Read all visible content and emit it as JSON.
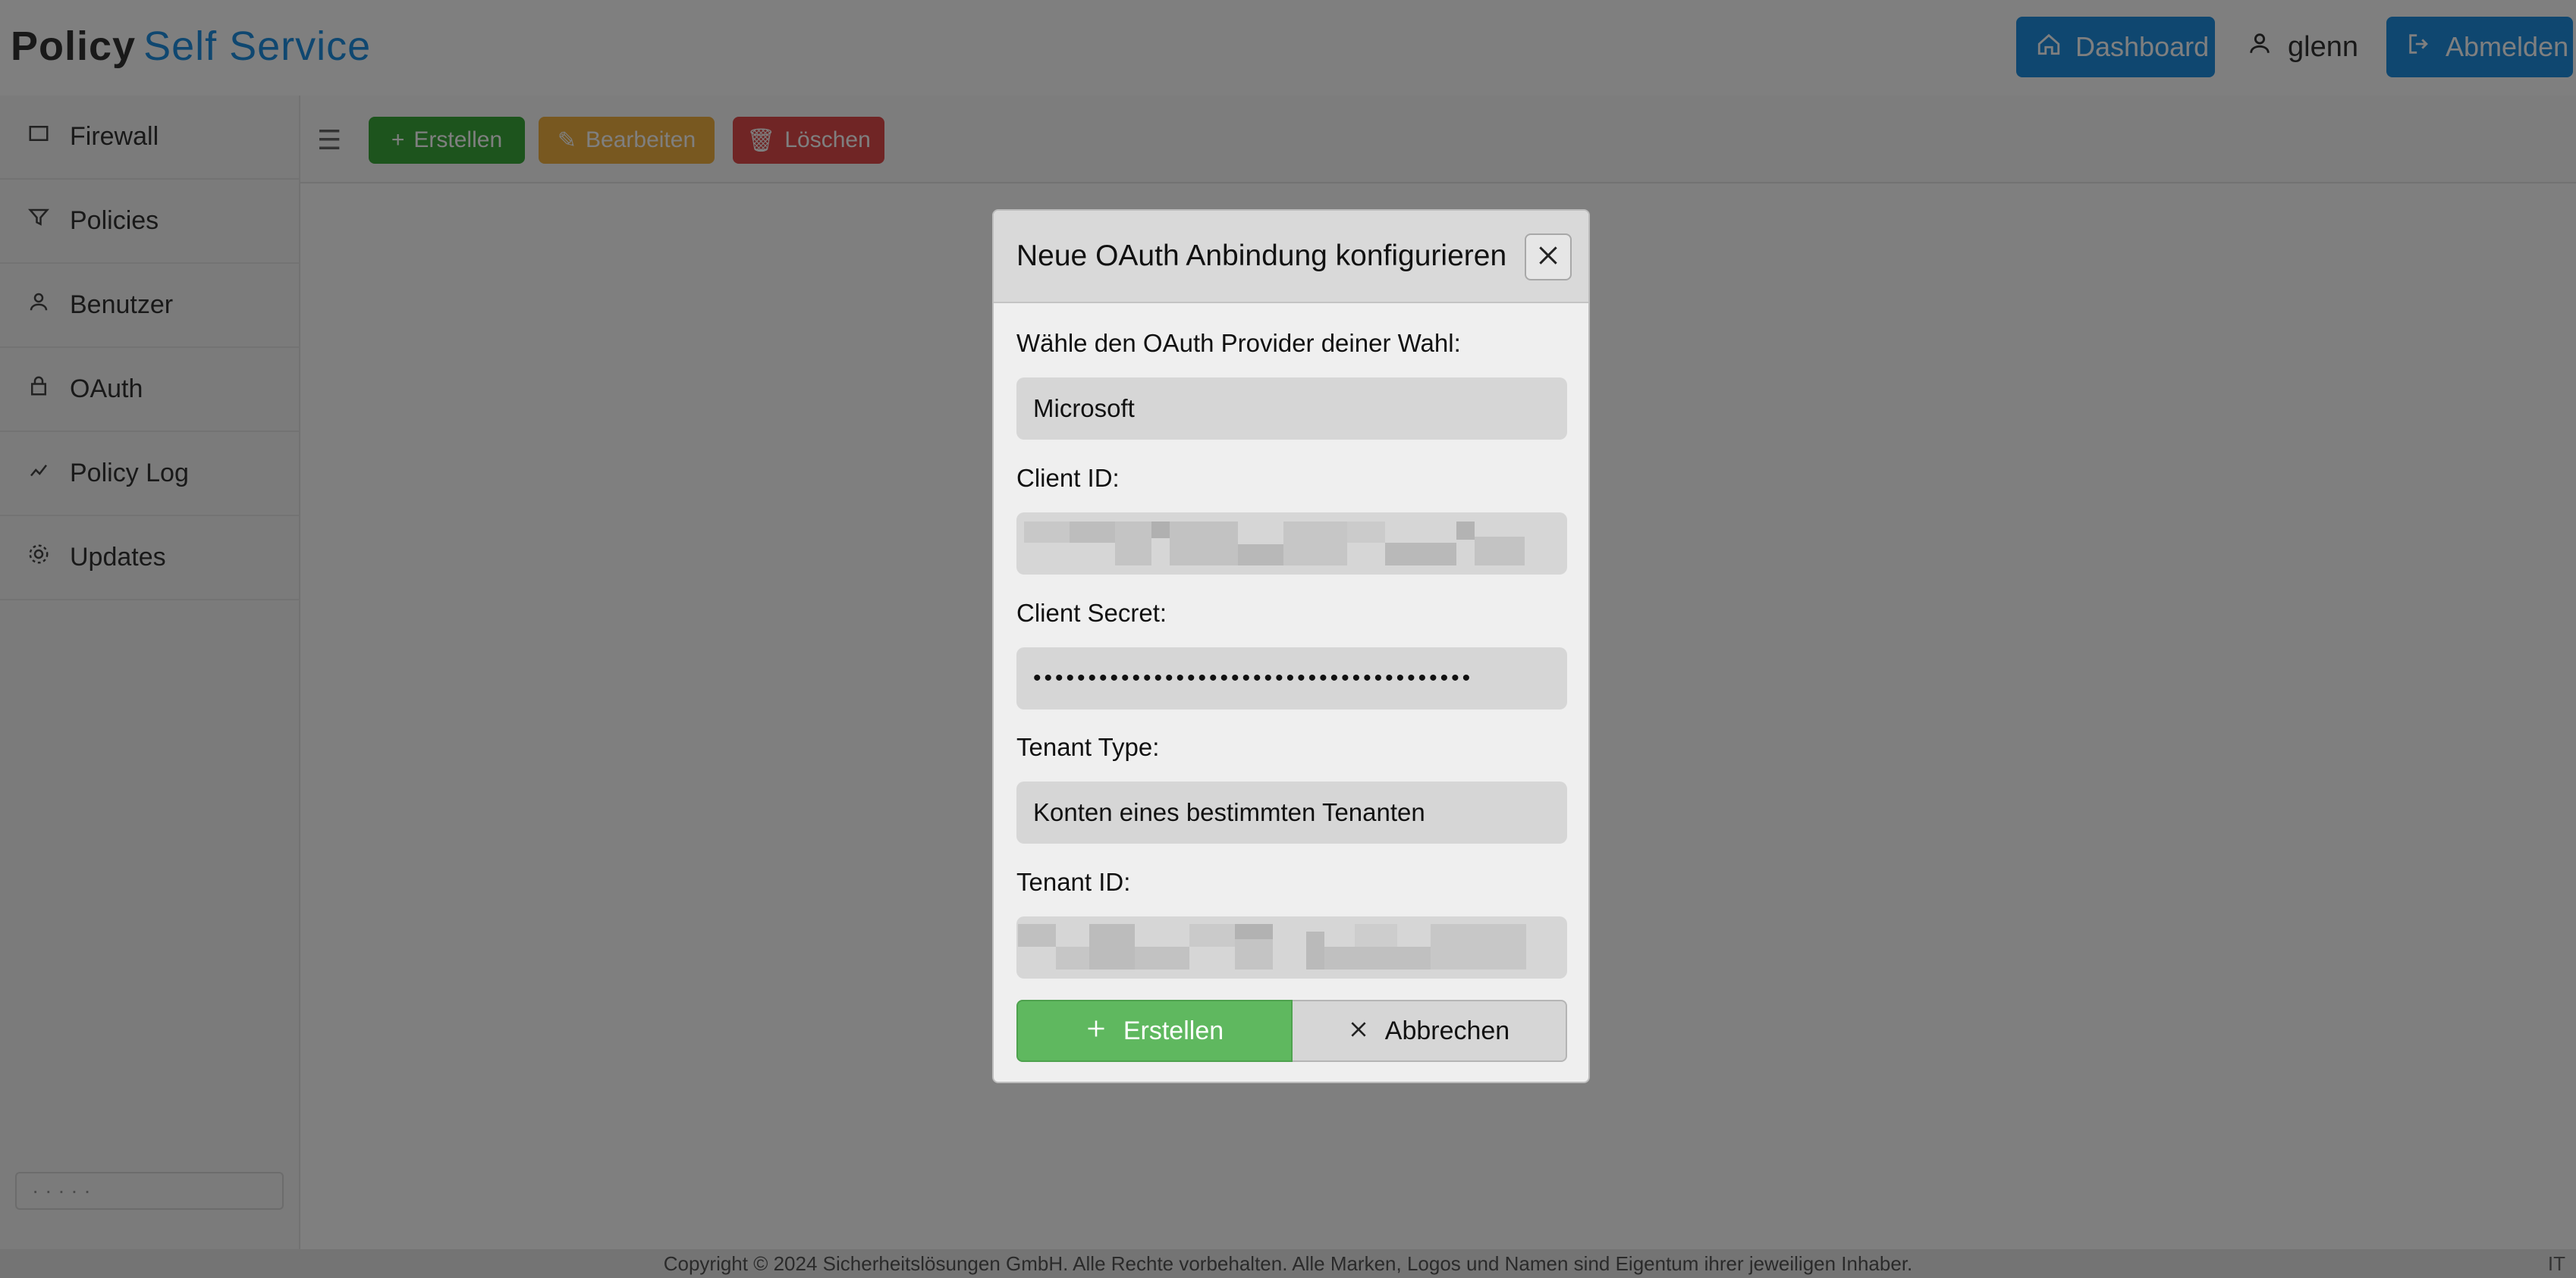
{
  "app": {
    "brand_primary": "Policy",
    "brand_secondary": "Self Service",
    "dashboard_label": "Dashboard",
    "user_label": "glenn",
    "logout_label": "Abmelden"
  },
  "sidebar": {
    "items": [
      {
        "label": "Firewall",
        "icon": "firewall-icon"
      },
      {
        "label": "Policies",
        "icon": "filter-icon"
      },
      {
        "label": "Benutzer",
        "icon": "user-icon"
      },
      {
        "label": "OAuth",
        "icon": "lock-icon"
      },
      {
        "label": "Policy Log",
        "icon": "log-icon"
      },
      {
        "label": "Updates",
        "icon": "gear-icon"
      }
    ],
    "bottom_label": "· · · · ·"
  },
  "toolbar": {
    "create_label": "Erstellen",
    "edit_label": "Bearbeiten",
    "delete_label": "Löschen"
  },
  "footer": {
    "text": "Copyright © 2024 Sicherheitslösungen GmbH. Alle Rechte vorbehalten. Alle Marken, Logos und Namen sind Eigentum ihrer jeweiligen Inhaber.",
    "corner": "IT"
  },
  "modal": {
    "title": "Neue OAuth Anbindung konfigurieren",
    "provider_label": "Wähle den OAuth Provider deiner Wahl:",
    "provider_value": "Microsoft",
    "client_id_label": "Client ID:",
    "client_secret_label": "Client Secret:",
    "client_secret_value": "••••••••••••••••••••••••••••••••••••••••",
    "tenant_type_label": "Tenant Type:",
    "tenant_type_value": "Konten eines bestimmten Tenanten",
    "tenant_id_label": "Tenant ID:",
    "create_button": "Erstellen",
    "cancel_button": "Abbrechen"
  },
  "colors": {
    "accent_blue": "#1f8fe0",
    "create_green": "#5fb85f",
    "edit_orange": "#f0b040",
    "delete_red": "#e04a4a"
  }
}
